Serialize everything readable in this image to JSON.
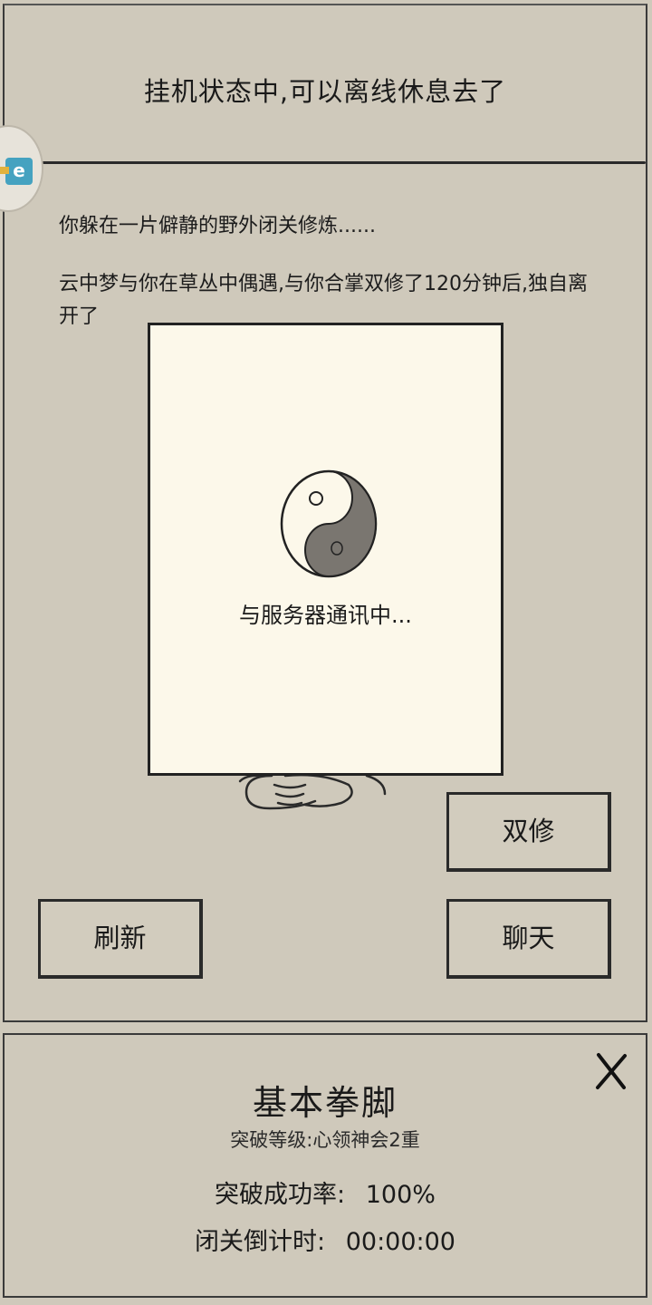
{
  "header": {
    "title": "挂机状态中,可以离线休息去了"
  },
  "log": {
    "lines": [
      "你躲在一片僻静的野外闭关修炼......",
      "云中梦与你在草丛中偶遇,与你合掌双修了120分钟后,独自离开了"
    ]
  },
  "dialog": {
    "message": "与服务器通讯中..."
  },
  "buttons": {
    "shuangxiu": "双修",
    "refresh": "刷新",
    "chat": "聊天"
  },
  "skill": {
    "name": "基本拳脚",
    "level": "突破等级:心领神会2重",
    "success_label": "突破成功率:",
    "success_value": "100%",
    "countdown_label": "闭关倒计时:",
    "countdown_value": "00:00:00"
  },
  "icons": {
    "side": "chat-bubble-icon",
    "close": "close-icon",
    "loading": "taiji-icon"
  },
  "colors": {
    "background": "#cfc9bb",
    "dialog_bg": "#fcf8ea",
    "ink": "#1a1a1a",
    "accent_blue": "#45a2c0"
  }
}
